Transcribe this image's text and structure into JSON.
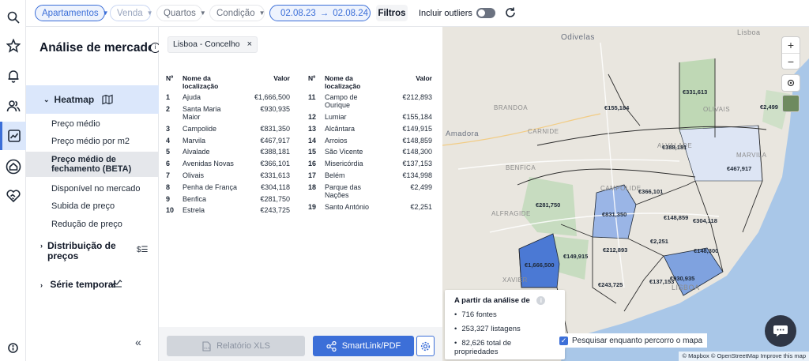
{
  "topbar": {
    "property_type": "Apartamentos",
    "deal_type": "Venda",
    "rooms": "Quartos",
    "condition": "Condição",
    "date_from": "02.08.23",
    "date_arrow": "→",
    "date_to": "02.08.24",
    "filters_label": "Filtros",
    "outliers_label": "Incluir outliers",
    "outliers_enabled": false
  },
  "panel": {
    "title": "Análise de mercado",
    "heatmap_label": "Heatmap",
    "items": [
      {
        "label": "Preço médio"
      },
      {
        "label": "Preço médio por m2"
      },
      {
        "label": "Preço médio de fechamento (BETA)",
        "selected": true
      },
      {
        "label": "Disponível no mercado"
      },
      {
        "label": "Subida de preço"
      },
      {
        "label": "Redução de preço"
      }
    ],
    "groups": [
      {
        "label": "Distribuição de preços"
      },
      {
        "label": "Série temporal"
      }
    ],
    "collapse_label": "«"
  },
  "filter_chip": {
    "label": "Lisboa - Concelho",
    "remove": "×"
  },
  "table": {
    "col_num": "Nº",
    "col_name": "Nome da localização",
    "col_value": "Valor",
    "left": [
      {
        "n": "1",
        "name": "Ajuda",
        "value": "€1,666,500"
      },
      {
        "n": "2",
        "name": "Santa Maria Maior",
        "value": "€930,935"
      },
      {
        "n": "3",
        "name": "Campolide",
        "value": "€831,350"
      },
      {
        "n": "4",
        "name": "Marvila",
        "value": "€467,917"
      },
      {
        "n": "5",
        "name": "Alvalade",
        "value": "€388,181"
      },
      {
        "n": "6",
        "name": "Avenidas Novas",
        "value": "€366,101"
      },
      {
        "n": "7",
        "name": "Olivais",
        "value": "€331,613"
      },
      {
        "n": "8",
        "name": "Penha de França",
        "value": "€304,118"
      },
      {
        "n": "9",
        "name": "Benfica",
        "value": "€281,750"
      },
      {
        "n": "10",
        "name": "Estrela",
        "value": "€243,725"
      }
    ],
    "right": [
      {
        "n": "11",
        "name": "Campo de Ourique",
        "value": "€212,893"
      },
      {
        "n": "12",
        "name": "Lumiar",
        "value": "€155,184"
      },
      {
        "n": "13",
        "name": "Alcântara",
        "value": "€149,915"
      },
      {
        "n": "14",
        "name": "Arroios",
        "value": "€148,859"
      },
      {
        "n": "15",
        "name": "São Vicente",
        "value": "€148,300"
      },
      {
        "n": "16",
        "name": "Misericórdia",
        "value": "€137,153"
      },
      {
        "n": "17",
        "name": "Belém",
        "value": "€134,998"
      },
      {
        "n": "18",
        "name": "Parque das Nações",
        "value": "€2,499"
      },
      {
        "n": "19",
        "name": "Santo António",
        "value": "€2,251"
      }
    ]
  },
  "actions": {
    "xls_label": "Relatório XLS",
    "smartlink_label": "SmartLink/PDF"
  },
  "map": {
    "place_names": [
      "Odivelas",
      "Amadora",
      "CARNIDE",
      "BENFICA",
      "ALVALADE",
      "OLIVAIS",
      "MARVILA",
      "CAMPOLIDE",
      "ALFRAGIDE",
      "LISBOA",
      "XAVIER",
      "Lisboa",
      "BRANDOA"
    ],
    "region_labels": [
      "€331,613",
      "€155,184",
      "€2,499",
      "€388,181",
      "€467,917",
      "€366,101",
      "€281,750",
      "€831,350",
      "€148,859",
      "€304,118",
      "€2,251",
      "€212,893",
      "€149,915",
      "€148,300",
      "€1,666,500",
      "€930,935",
      "€137,153",
      "€243,725"
    ],
    "info_title": "A partir da análise de",
    "info_items": [
      "716 fontes",
      "253,327 listagens",
      "82,626 total de propriedades"
    ],
    "search_label": "Pesquisar enquanto percorro o mapa",
    "search_checked": true,
    "attribution": "© Mapbox © OpenStreetMap  Improve this map",
    "zoom_in": "+",
    "zoom_out": "−"
  }
}
